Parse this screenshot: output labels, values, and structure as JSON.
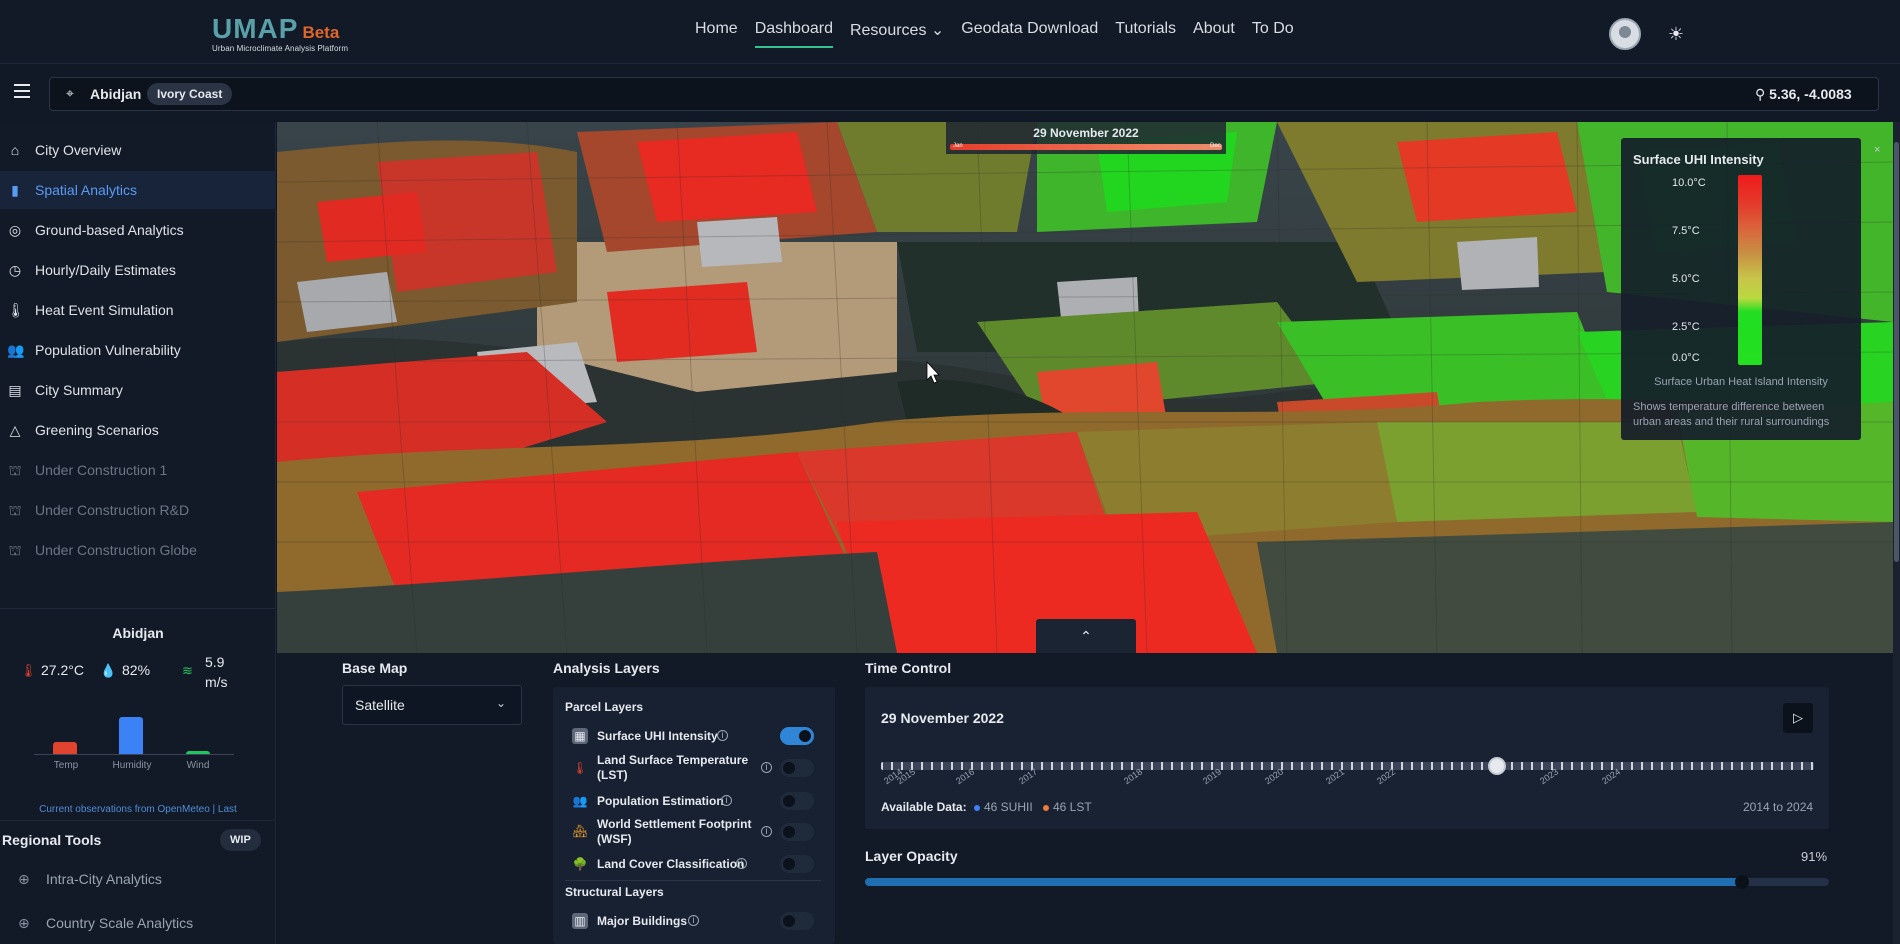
{
  "nav": {
    "logo_main": "UMAP",
    "logo_beta": "Beta",
    "logo_sub": "Urban Microclimate Analysis Platform",
    "links": [
      {
        "label": "Home"
      },
      {
        "label": "Dashboard"
      },
      {
        "label": "Resources ⌄"
      },
      {
        "label": "Geodata Download"
      },
      {
        "label": "Tutorials"
      },
      {
        "label": "About"
      },
      {
        "label": "To Do"
      }
    ],
    "active_link": "Dashboard"
  },
  "location": {
    "city": "Abidjan",
    "country": "Ivory Coast",
    "coords": "5.36, -4.0083"
  },
  "sidebar": {
    "items": [
      {
        "label": "City Overview",
        "icon": "home-icon"
      },
      {
        "label": "Spatial Analytics",
        "icon": "chart-bars-icon"
      },
      {
        "label": "Ground-based Analytics",
        "icon": "satellite-icon"
      },
      {
        "label": "Hourly/Daily Estimates",
        "icon": "clock-icon"
      },
      {
        "label": "Heat Event Simulation",
        "icon": "thermometer-icon"
      },
      {
        "label": "Population Vulnerability",
        "icon": "users-icon"
      },
      {
        "label": "City Summary",
        "icon": "document-icon"
      },
      {
        "label": "Greening Scenarios",
        "icon": "bell-icon"
      },
      {
        "label": "Under Construction 1",
        "icon": "construction-icon"
      },
      {
        "label": "Under Construction R&D",
        "icon": "construction-icon"
      },
      {
        "label": "Under Construction Globe",
        "icon": "construction-icon"
      }
    ],
    "active_item": "Spatial Analytics"
  },
  "weather": {
    "city": "Abidjan",
    "temp": "27.2°C",
    "humidity": "82%",
    "wind": "5.9",
    "wind_unit": "m/s",
    "bars": [
      {
        "label": "Temp",
        "value": 0.27,
        "color": "#e0432e"
      },
      {
        "label": "Humidity",
        "value": 0.82,
        "color": "#3b82f6"
      },
      {
        "label": "Wind",
        "value": 0.06,
        "color": "#22c55e"
      }
    ],
    "note": "Current observations from OpenMeteo | Last"
  },
  "regional": {
    "title": "Regional Tools",
    "badge": "WIP",
    "items": [
      {
        "label": "Intra-City Analytics"
      },
      {
        "label": "Country Scale Analytics"
      }
    ]
  },
  "map": {
    "date_label": "29 November 2022",
    "band_start": "Jan",
    "band_end": "Dec",
    "legend": {
      "title": "Surface UHI Intensity",
      "ticks": [
        "10.0°C",
        "7.5°C",
        "5.0°C",
        "2.5°C",
        "0.0°C"
      ],
      "caption": "Surface Urban Heat Island Intensity",
      "description": "Shows temperature difference between urban areas and their rural surroundings",
      "close": "×"
    },
    "collapse": "⌃"
  },
  "basemap": {
    "title": "Base Map",
    "selected": "Satellite"
  },
  "layers": {
    "title": "Analysis Layers",
    "parcel_title": "Parcel Layers",
    "structural_title": "Structural Layers",
    "parcel": [
      {
        "label": "Surface UHI Intensity",
        "on": true
      },
      {
        "label": "Land Surface Temperature (LST)",
        "on": false
      },
      {
        "label": "Population Estimation",
        "on": false
      },
      {
        "label": "World Settlement Footprint (WSF)",
        "on": false
      },
      {
        "label": "Land Cover Classification",
        "on": false
      }
    ],
    "structural": [
      {
        "label": "Major Buildings",
        "on": false
      }
    ]
  },
  "time": {
    "title": "Time Control",
    "date": "29 November 2022",
    "years": [
      "2014",
      "2015",
      "2016",
      "2017",
      "2018",
      "2019",
      "2020",
      "2021",
      "2022",
      "2023",
      "2024"
    ],
    "position": 0.66,
    "available_label": "Available Data:",
    "suhii": "46 SUHII",
    "lst": "46 LST",
    "range": "2014 to 2024"
  },
  "opacity": {
    "title": "Layer Opacity",
    "value": 0.91,
    "label": "91%"
  }
}
